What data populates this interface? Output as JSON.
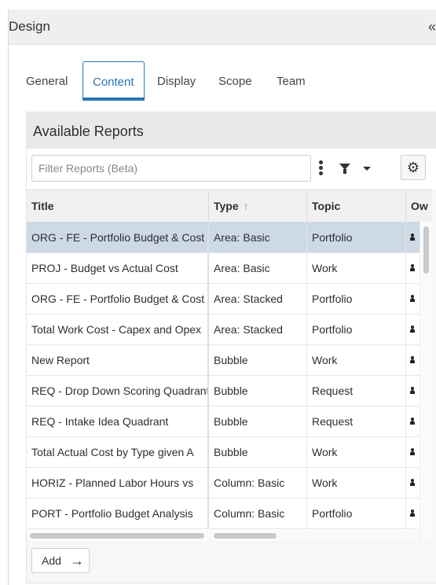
{
  "panel": {
    "title": "Design",
    "collapse_glyph": "«"
  },
  "tabs": [
    {
      "label": "General",
      "active": false
    },
    {
      "label": "Content",
      "active": true
    },
    {
      "label": "Display",
      "active": false
    },
    {
      "label": "Scope",
      "active": false
    },
    {
      "label": "Team",
      "active": false
    }
  ],
  "reports": {
    "title": "Available Reports",
    "filter_placeholder": "Filter Reports (Beta)",
    "columns": [
      "Title",
      "Type",
      "Topic",
      "Ow"
    ],
    "sort_glyph": "↑",
    "rows": [
      {
        "title": "ORG - FE - Portfolio Budget & Cost",
        "type": "Area: Basic",
        "topic": "Portfolio",
        "selected": true
      },
      {
        "title": "PROJ - Budget vs Actual Cost",
        "type": "Area: Basic",
        "topic": "Work",
        "selected": false
      },
      {
        "title": "ORG - FE - Portfolio Budget & Cost",
        "type": "Area: Stacked",
        "topic": "Portfolio",
        "selected": false
      },
      {
        "title": "Total Work Cost - Capex and Opex",
        "type": "Area: Stacked",
        "topic": "Portfolio",
        "selected": false
      },
      {
        "title": "New Report",
        "type": "Bubble",
        "topic": "Work",
        "selected": false
      },
      {
        "title": "REQ - Drop Down Scoring Quadrant",
        "type": "Bubble",
        "topic": "Request",
        "selected": false
      },
      {
        "title": "REQ - Intake Idea Quadrant",
        "type": "Bubble",
        "topic": "Request",
        "selected": false
      },
      {
        "title": "Total Actual Cost by Type given A",
        "type": "Bubble",
        "topic": "Work",
        "selected": false
      },
      {
        "title": "HORIZ - Planned Labor Hours vs",
        "type": "Column: Basic",
        "topic": "Work",
        "selected": false
      },
      {
        "title": "PORT - Portfolio Budget Analysis",
        "type": "Column: Basic",
        "topic": "Portfolio",
        "selected": false
      }
    ],
    "add_label": "Add",
    "add_glyph": "→",
    "settings_glyph": "⚙"
  },
  "colors": {
    "accent": "#2a74b8",
    "selected_row": "#cdd9e5"
  }
}
